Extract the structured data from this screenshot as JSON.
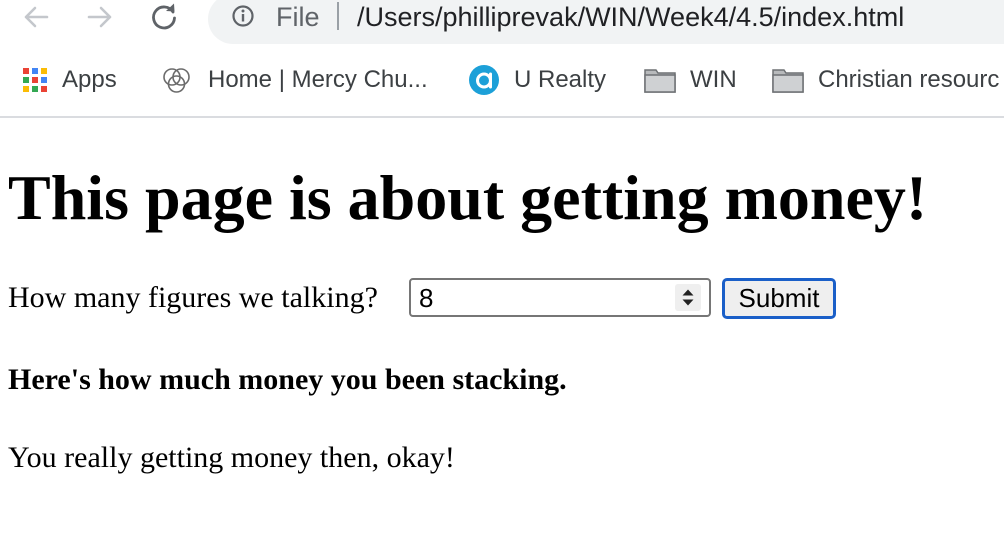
{
  "browser": {
    "address": {
      "scheme_label": "File",
      "url": "/Users/philliprevak/WIN/Week4/4.5/index.html"
    },
    "bookmarks": [
      {
        "label": "Apps",
        "icon": "apps-grid-icon"
      },
      {
        "label": "Home | Mercy Chu...",
        "icon": "mercy-church-logo-icon"
      },
      {
        "label": "U Realty",
        "icon": "u-realty-logo-icon"
      },
      {
        "label": "WIN",
        "icon": "folder-icon"
      },
      {
        "label": "Christian resourc",
        "icon": "folder-icon"
      }
    ]
  },
  "page": {
    "heading": "This page is about getting money!",
    "question_label": "How many figures we talking?",
    "figures_input_value": "8",
    "submit_label": "Submit",
    "stacking_text": "Here's how much money you been stacking.",
    "result_text": "You really getting money then, okay!"
  },
  "colors": {
    "omnibox_bg": "#f1f3f4",
    "submit_focus_ring": "#1a5fc8",
    "u_realty_blue": "#1ca0d8"
  }
}
